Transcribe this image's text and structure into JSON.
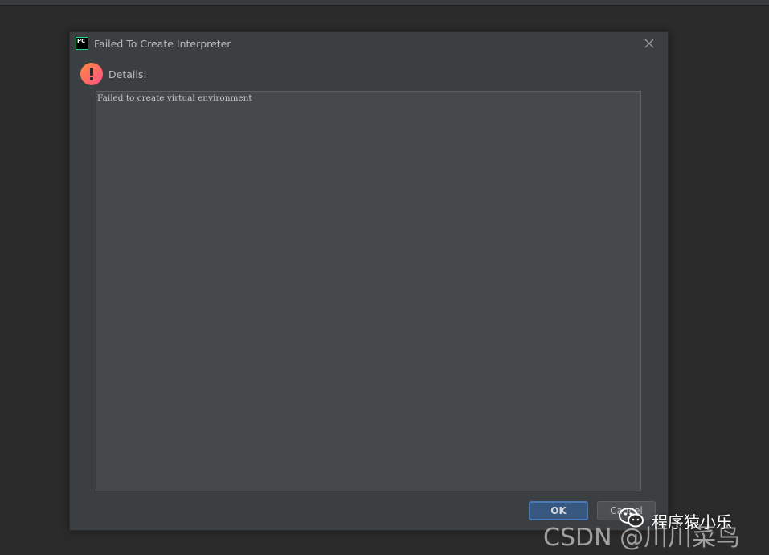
{
  "dialog": {
    "title": "Failed To Create Interpreter",
    "app_icon_text": "PC",
    "details_label": "Details:",
    "details_text": "Failed to create virtual environment",
    "buttons": {
      "ok_label": "OK",
      "cancel_label": "Cancel"
    }
  },
  "watermark": {
    "line1": "程序猿小乐",
    "line2": "CSDN @川川菜鸟",
    "icon": "wechat-icon"
  },
  "colors": {
    "background": "#2b2b2b",
    "dialog_bg": "#3c3f41",
    "text_area_bg": "#45494a",
    "ok_button_bg": "#365880",
    "ok_button_border": "#4a78b4",
    "error_gradient_start": "#ff8a3c",
    "error_gradient_end": "#ff4f8a"
  },
  "icons": {
    "app": "pycharm-icon",
    "close": "close-icon",
    "error": "error-icon"
  }
}
